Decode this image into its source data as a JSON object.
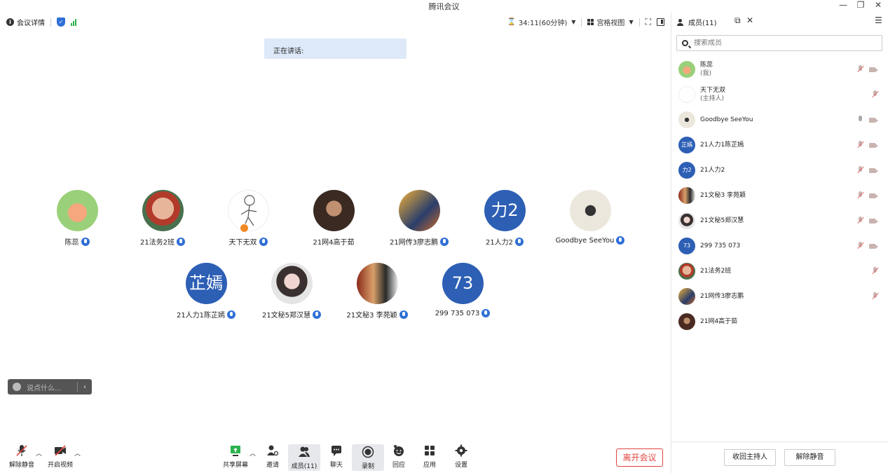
{
  "window": {
    "title": "腾讯会议"
  },
  "toolbar": {
    "meeting_details": "会议详情",
    "timer": "34:11(60分钟)",
    "view_mode": "宫格视图"
  },
  "speaking": {
    "label": "正在讲话:"
  },
  "participants": [
    {
      "name": "陈蕊"
    },
    {
      "name": "21法务2班"
    },
    {
      "name": "天下无双"
    },
    {
      "name": "21网4高于茹"
    },
    {
      "name": "21网传3廖志鹏"
    },
    {
      "name": "21人力2",
      "avatar_text": "力2"
    },
    {
      "name": "Goodbye SeeYou"
    },
    {
      "name": "21人力1陈芷嫣",
      "avatar_text": "芷嫣"
    },
    {
      "name": "21文秘5郑汉慧"
    },
    {
      "name": "21文秘3 李苑颖"
    },
    {
      "name": "299 735 073",
      "avatar_text": "73"
    }
  ],
  "chat": {
    "placeholder": "说点什么..."
  },
  "bottom": {
    "unmute": "解除静音",
    "start_video": "开启视频",
    "share_screen": "共享屏幕",
    "invite": "邀请",
    "members": "成员(11)",
    "chat": "聊天",
    "record": "录制",
    "reactions": "回应",
    "apps": "应用",
    "settings": "设置",
    "leave": "离开会议"
  },
  "panel": {
    "title": "成员(11)",
    "search_placeholder": "搜索成员",
    "members": [
      {
        "name": "陈蕊",
        "sub": "(我)"
      },
      {
        "name": "天下无双",
        "sub": "(主持人)"
      },
      {
        "name": "Goodbye SeeYou"
      },
      {
        "name": "21人力1陈芷嫣",
        "avatar_text": "芷嫣"
      },
      {
        "name": "21人力2",
        "avatar_text": "力2"
      },
      {
        "name": "21文秘3 李苑颖"
      },
      {
        "name": "21文秘5郑汉慧"
      },
      {
        "name": "299 735 073",
        "avatar_text": "73"
      },
      {
        "name": "21法务2班"
      },
      {
        "name": "21网传3廖志鹏"
      },
      {
        "name": "21网4高于茹"
      }
    ],
    "reclaim_host": "收回主持人",
    "unmute_all": "解除静音"
  },
  "colors": {
    "accent": "#2f6fd6",
    "avatar_blue": "#2d5fb5",
    "leave_red": "#e0453f"
  }
}
